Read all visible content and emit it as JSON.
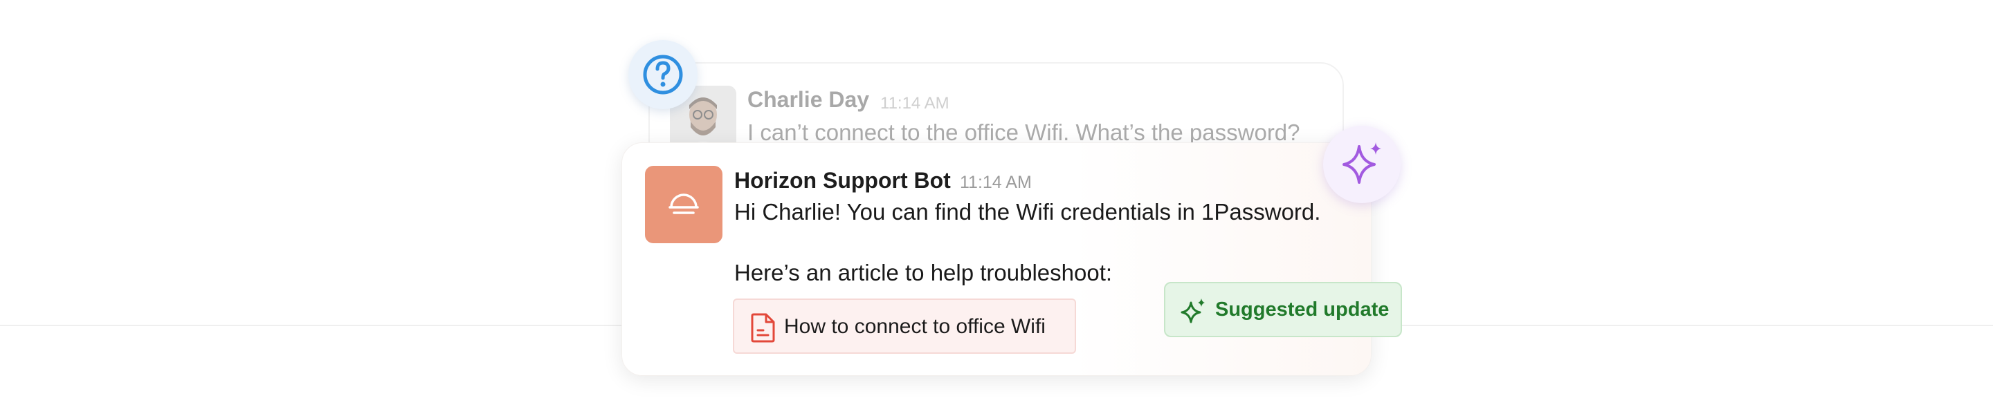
{
  "user_message": {
    "name": "Charlie Day",
    "time": "11:14 AM",
    "text": "I can’t connect to the office Wifi. What’s the password?"
  },
  "bot_message": {
    "name": "Horizon Support Bot",
    "time": "11:14 AM",
    "line1": "Hi Charlie! You can find the Wifi credentials in 1Password.",
    "line2": "Here’s an article to help troubleshoot:",
    "article_link": "How to connect to office Wifi"
  },
  "suggestion": {
    "label": "Suggested update"
  },
  "icons": {
    "question": "question-circle-icon",
    "sparkle": "sparkle-icon",
    "document": "document-icon",
    "bot_logo": "horizon-logo-icon"
  },
  "colors": {
    "accent_blue": "#2f8fe0",
    "bot_avatar": "#ea9679",
    "sparkle_purple": "#a25ae0",
    "suggest_green": "#217a2b",
    "document_red": "#e2483a"
  }
}
